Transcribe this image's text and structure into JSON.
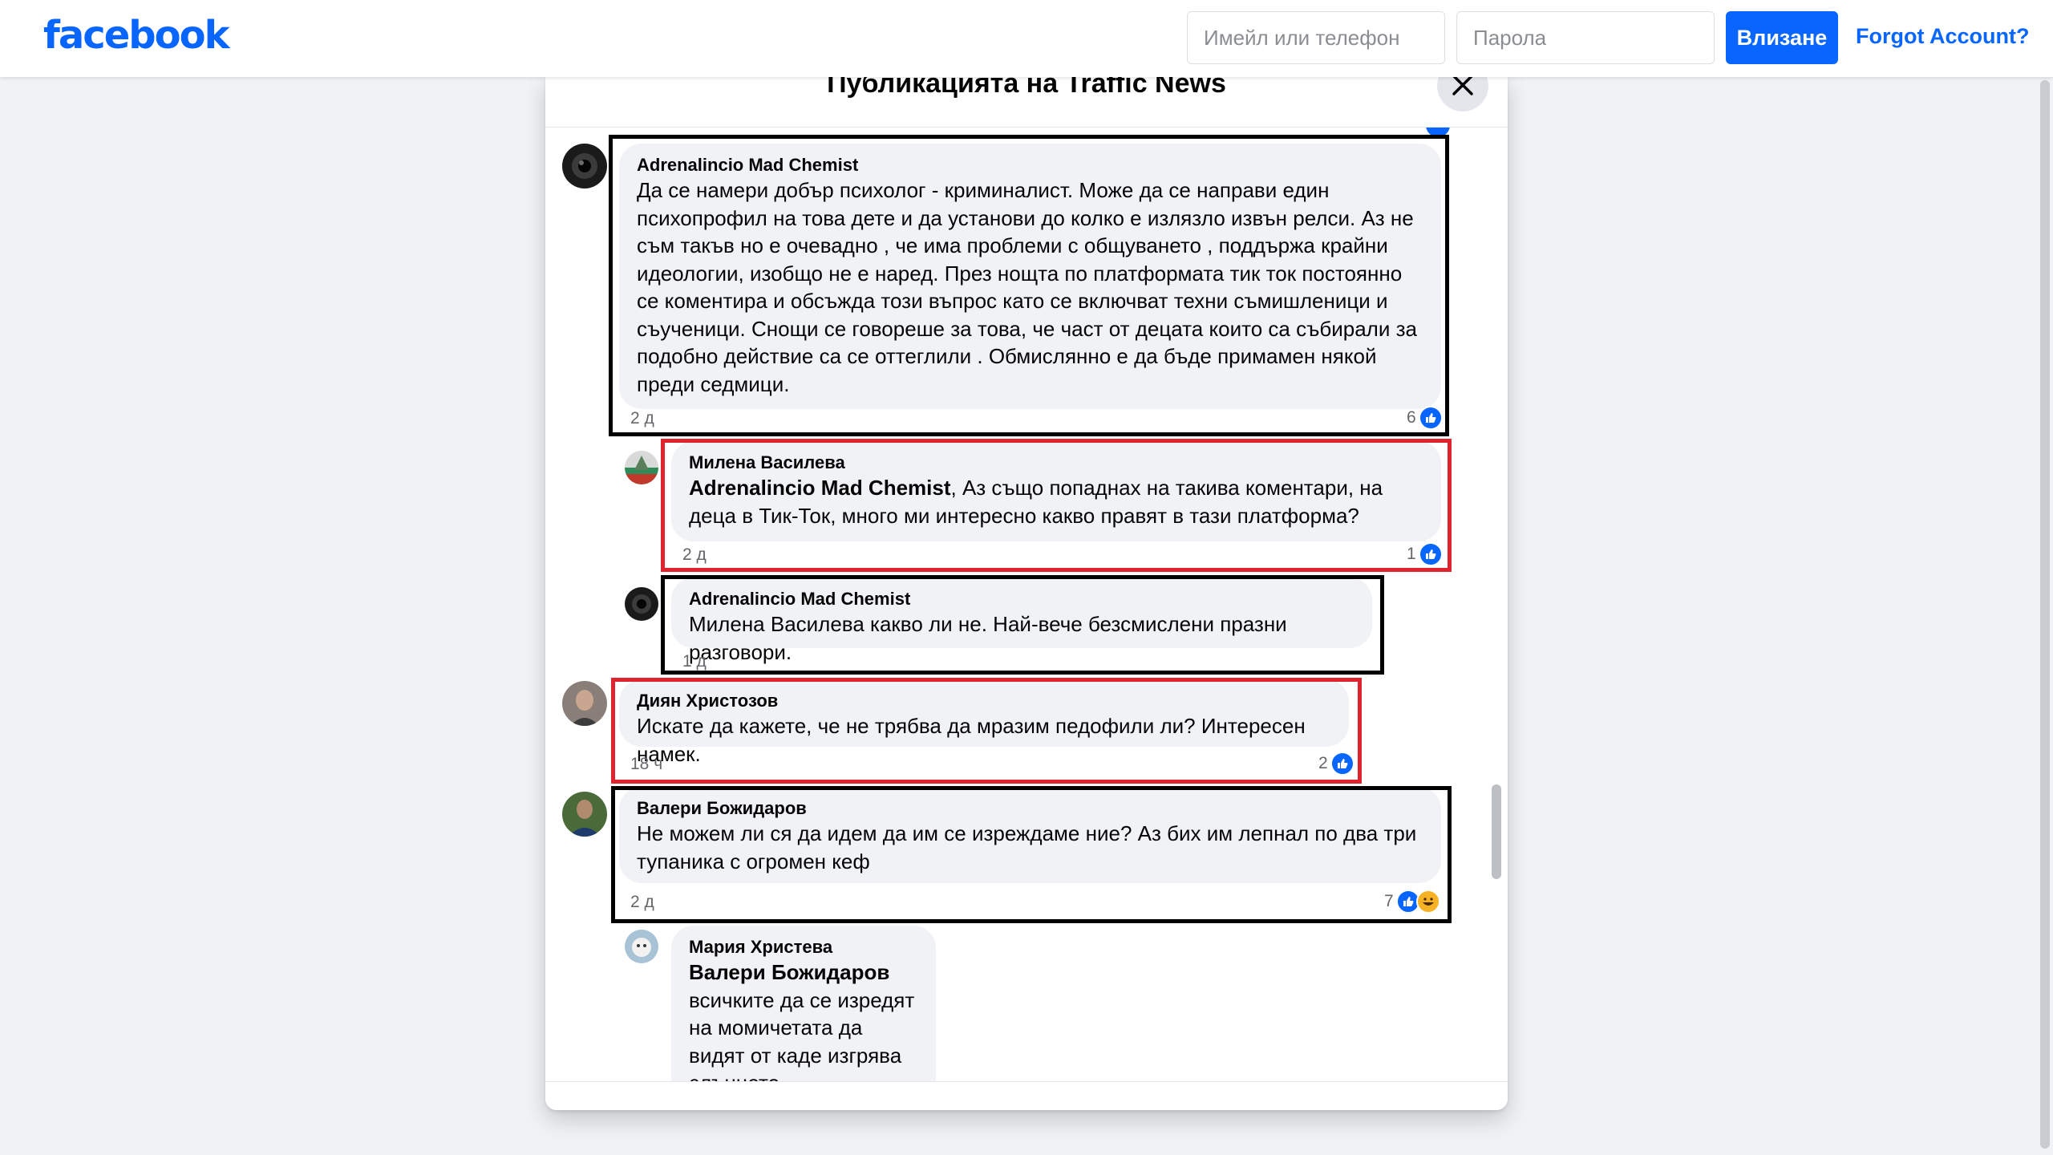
{
  "brand": {
    "logo_text": "facebook",
    "accent": "#0866ff"
  },
  "login": {
    "email_placeholder": "Имейл или телефон",
    "password_placeholder": "Парола",
    "login_label": "Влизане",
    "forgot_label": "Forgot Account?"
  },
  "dialog": {
    "title": "Публикацията на Traffic News"
  },
  "comments": [
    {
      "author": "Adrenalincio Mad Chemist",
      "mention": "",
      "text": "Да се намери добър психолог - криминалист. Може да се направи един психопрофил на това дете и да установи до колко е излязло извън релси. Аз не съм такъв но е очевадно , че има проблеми с общуването , поддържа крайни идеологии, изобщо не е наред. През нощта по платформата тик ток постоянно се коментира и обсъжда този въпрос като се включват техни съмишленици и съученици. Снощи се говореше за това, че част от децата които са събирали за подобно действие са се оттеглили . Обмислянно е да бъде примамен някой преди седмици.",
      "time": "2 д",
      "reactions": "6",
      "highlight": "black"
    },
    {
      "author": "Милена Василева",
      "mention": "Adrenalincio Mad Chemist",
      "text": ", Аз също попаднах на такива коментари, на деца в Тик-Ток, много ми интересно какво правят в тази платформа?",
      "time": "2 д",
      "reactions": "1",
      "highlight": "red"
    },
    {
      "author": "Adrenalincio Mad Chemist",
      "mention": "",
      "text": "Милена Василева какво ли не. Най-вече безсмислени празни разговори.",
      "time": "1 д",
      "reactions": "",
      "highlight": "black"
    },
    {
      "author": "Диян Христозов",
      "mention": "",
      "text": "Искате да кажете, че не трябва да мразим педофили ли? Интересен намек.",
      "time": "18 ч",
      "reactions": "2",
      "highlight": "red"
    },
    {
      "author": "Валери Божидаров",
      "mention": "",
      "text": "Не можем ли ся да идем да им се изреждаме ние? Аз бих им лепнал по два три тупаника с огромен кеф",
      "time": "2 д",
      "reactions": "7",
      "highlight": "black"
    },
    {
      "author": "Мария Христева",
      "mention": "Валери Божидаров",
      "text": "всичките да се изредят на момичетата да видят от каде изгрява слънцето",
      "time": "",
      "reactions": "",
      "highlight": ""
    }
  ],
  "icons": [
    "close-icon",
    "like-icon",
    "haha-icon"
  ],
  "colors": {
    "highlight_black": "#000000",
    "highlight_red": "#e0242f",
    "like_blue": "#0866ff",
    "bubble": "#f0f2f5"
  }
}
